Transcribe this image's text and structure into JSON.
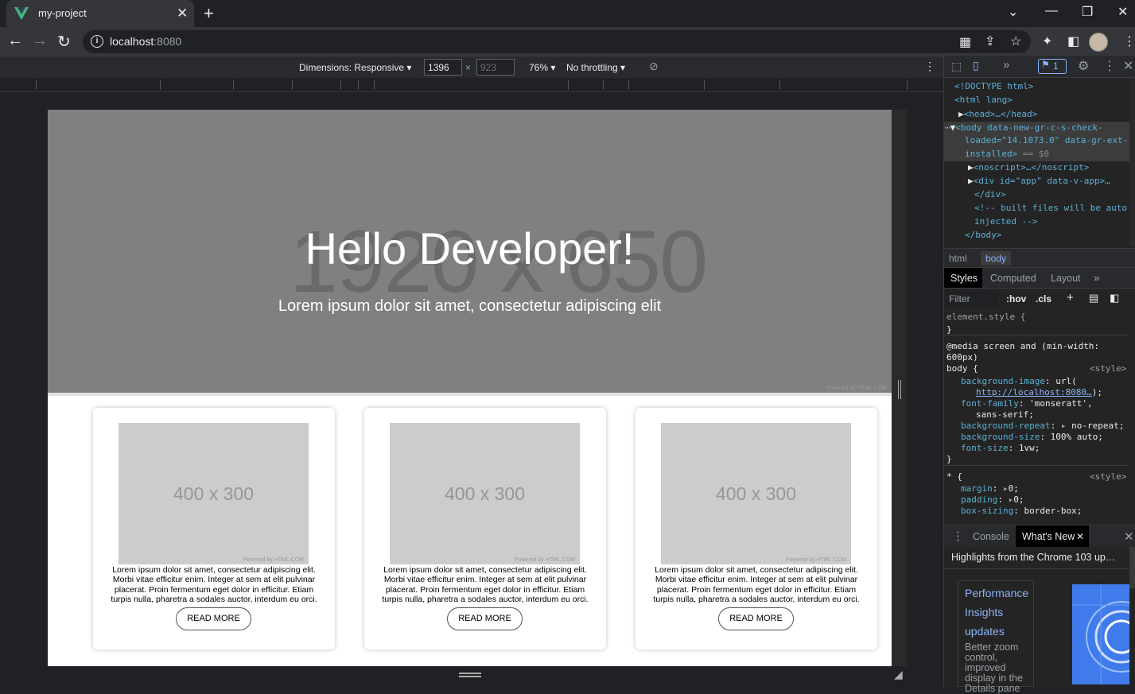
{
  "browser": {
    "tab_title": "my-project",
    "tab_close": "✕",
    "new_tab": "+",
    "url_host": "localhost",
    "url_port": ":8080"
  },
  "device_toolbar": {
    "dimensions_label": "Dimensions: Responsive",
    "width": "1396",
    "height_placeholder": "923",
    "times": "×",
    "zoom": "76%",
    "throttling": "No throttling"
  },
  "page": {
    "hero": {
      "placeholder_text": "1920 x 650",
      "heading": "Hello Developer!",
      "subheading": "Lorem ipsum dolor sit amet, consectetur adipiscing elit",
      "powered": "Powered by HTML.COM"
    },
    "cards": [
      {
        "image_text": "400 x 300",
        "powered": "Powered by HTML.COM",
        "body": "Lorem ipsum dolor sit amet, consectetur adipiscing elit. Morbi vitae efficitur enim. Integer at sem at elit pulvinar placerat. Proin fermentum eget dolor in efficitur. Etiam turpis nulla, pharetra a sodales auctor, interdum eu orci.",
        "button": "READ MORE"
      },
      {
        "image_text": "400 x 300",
        "powered": "Powered by HTML.COM",
        "body": "Lorem ipsum dolor sit amet, consectetur adipiscing elit. Morbi vitae efficitur enim. Integer at sem at elit pulvinar placerat. Proin fermentum eget dolor in efficitur. Etiam turpis nulla, pharetra a sodales auctor, interdum eu orci.",
        "button": "READ MORE"
      },
      {
        "image_text": "400 x 300",
        "powered": "Powered by HTML.COM",
        "body": "Lorem ipsum dolor sit amet, consectetur adipiscing elit. Morbi vitae efficitur enim. Integer at sem at elit pulvinar placerat. Proin fermentum eget dolor in efficitur. Etiam turpis nulla, pharetra a sodales auctor, interdum eu orci.",
        "button": "READ MORE"
      }
    ]
  },
  "devtools": {
    "issues_count": "1",
    "elements": {
      "doctype": "<!DOCTYPE html>",
      "html_open": "<html lang>",
      "head": "<head>…</head>",
      "body_open_1": "<body data-new-gr-c-s-check-",
      "body_open_2": "loaded=\"14.1073.0\" data-gr-ext-",
      "body_open_3": "installed>",
      "body_eq": "== $0",
      "noscript": "<noscript>…</noscript>",
      "div_app": "<div id=\"app\" data-v-app>…",
      "div_close": "</div>",
      "comment_1": "<!-- built files will be auto",
      "comment_2": "injected -->",
      "body_close": "</body>"
    },
    "breadcrumbs": [
      "html",
      "body"
    ],
    "style_tabs": [
      "Styles",
      "Computed",
      "Layout"
    ],
    "more_tabs": "»",
    "filter_placeholder": "Filter",
    "hov": ":hov",
    "cls": ".cls",
    "styles": {
      "element_style": "element.style {",
      "close_brace": "}",
      "media_1": "@media screen and (min-width:",
      "media_2": "600px)",
      "body_sel": "body {",
      "source": "<style>",
      "bg_image_prop": "background-image",
      "bg_image_val": "url(",
      "bg_image_link": "http://localhost:8080…",
      "bg_image_end": ");",
      "font_family_prop": "font-family",
      "font_family_val": "'monseratt',",
      "font_family_val2": "sans-serif;",
      "bg_repeat_prop": "background-repeat",
      "bg_repeat_val": "no-repeat;",
      "bg_size_prop": "background-size",
      "bg_size_val": "100% auto;",
      "font_size_prop": "font-size",
      "font_size_val": "1vw;",
      "star_sel": "* {",
      "margin_prop": "margin",
      "margin_val": "0;",
      "padding_prop": "padding",
      "padding_val": "0;",
      "box_sizing_prop": "box-sizing",
      "box_sizing_val": "border-box;"
    },
    "drawer_tabs": [
      "Console",
      "What's New"
    ],
    "whats_new_title": "Highlights from the Chrome 103 up…",
    "news_heading": "Performance Insights updates",
    "news_body": "Better zoom control, improved display in the Details pane"
  }
}
